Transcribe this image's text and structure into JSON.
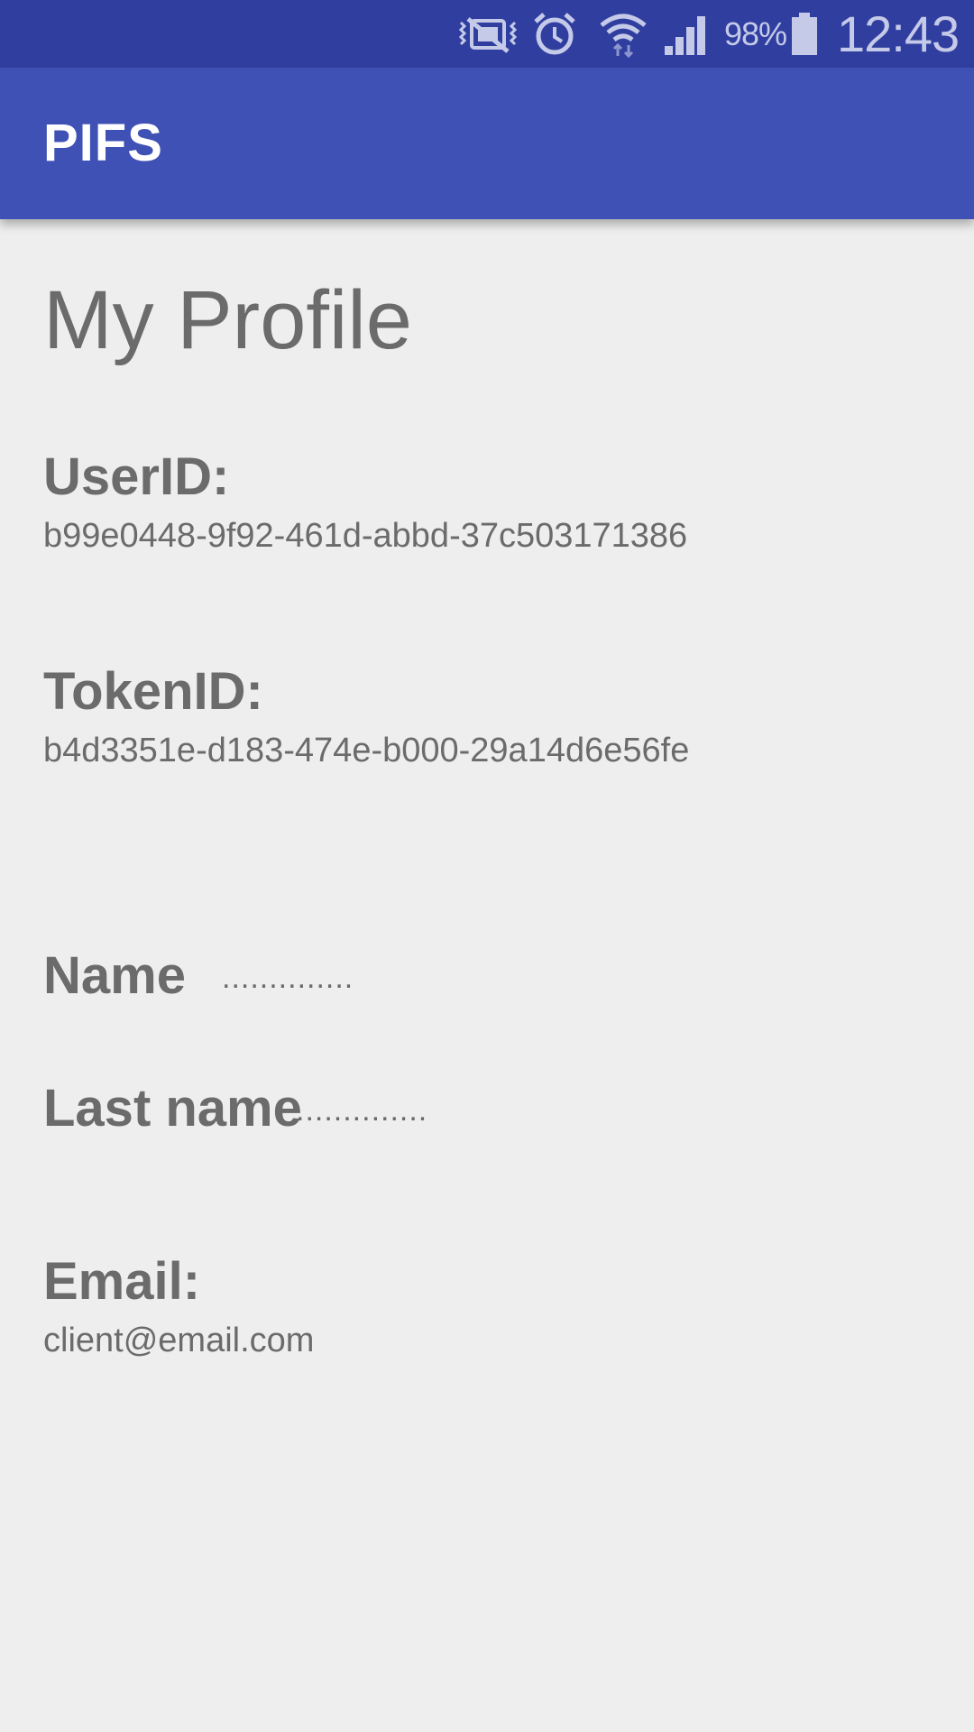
{
  "status_bar": {
    "icons": [
      "mute-vibrate-icon",
      "alarm-clock-icon",
      "wifi-icon",
      "cellular-signal-icon",
      "battery-icon"
    ],
    "battery_percent": "98%",
    "clock": "12:43"
  },
  "app_bar": {
    "title": "PIFS"
  },
  "profile": {
    "page_title": "My Profile",
    "user_id_label": "UserID:",
    "user_id_value": "b99e0448-9f92-461d-abbd-37c503171386",
    "token_id_label": "TokenID:",
    "token_id_value": "b4d3351e-d183-474e-b000-29a14d6e56fe",
    "name_label": "Name",
    "name_value": "..............",
    "last_name_label": "Last name",
    "last_name_value": "..............",
    "email_label": "Email:",
    "email_value": "client@email.com"
  },
  "colors": {
    "status_bar": "#303f9f",
    "app_bar": "#3f51b5",
    "background": "#eeeeef",
    "text": "#6b6b6b"
  }
}
